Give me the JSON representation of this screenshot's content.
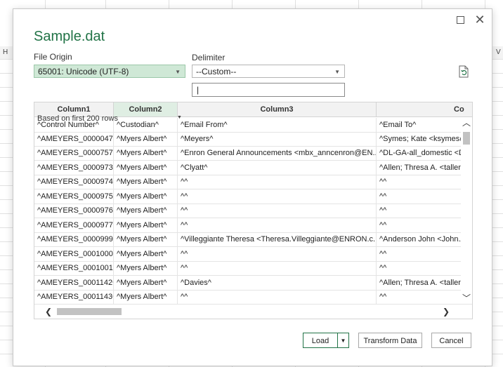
{
  "dialog": {
    "title": "Sample.dat",
    "file_origin_label": "File Origin",
    "file_origin_value": "65001: Unicode (UTF-8)",
    "delimiter_label": "Delimiter",
    "delimiter_value": "--Custom--",
    "custom_delimiter_value": "|",
    "sample_note": "Based on first 200 rows"
  },
  "background": {
    "col_letters": [
      "H",
      "V"
    ]
  },
  "table": {
    "headers": [
      "Column1",
      "Column2",
      "Column3",
      "Co"
    ],
    "rows": [
      [
        "^Control Number^",
        "^Custodian^",
        "^Email From^",
        "^Email To^"
      ],
      [
        "^AMEYERS_0000047^",
        "^Myers Albert^",
        "^Meyers^",
        "^Symes; Kate <ksymes@"
      ],
      [
        "^AMEYERS_0000757^",
        "^Myers Albert^",
        "^Enron General Announcements <mbx_anncenron@EN...",
        "^DL-GA-all_domestic <D"
      ],
      [
        "^AMEYERS_0000973^",
        "^Myers Albert^",
        "^Clyatt^",
        "^Allen; Thresa A. <tallen"
      ],
      [
        "^AMEYERS_0000974^",
        "^Myers Albert^",
        "^^",
        "^^"
      ],
      [
        "^AMEYERS_0000975^",
        "^Myers Albert^",
        "^^",
        "^^"
      ],
      [
        "^AMEYERS_0000976^",
        "^Myers Albert^",
        "^^",
        "^^"
      ],
      [
        "^AMEYERS_0000977^",
        "^Myers Albert^",
        "^^",
        "^^"
      ],
      [
        "^AMEYERS_0000999^",
        "^Myers Albert^",
        "^Villeggiante Theresa <Theresa.Villeggiante@ENRON.c...",
        "^Anderson John <John.A"
      ],
      [
        "^AMEYERS_0001000^",
        "^Myers Albert^",
        "^^",
        "^^"
      ],
      [
        "^AMEYERS_0001001^",
        "^Myers Albert^",
        "^^",
        "^^"
      ],
      [
        "^AMEYERS_0001142^",
        "^Myers Albert^",
        "^Davies^",
        "^Allen; Thresa A. <tallen"
      ],
      [
        "^AMEYERS_0001143^",
        "^Myers Albert^",
        "^^",
        "^^"
      ]
    ]
  },
  "buttons": {
    "load": "Load",
    "transform": "Transform Data",
    "cancel": "Cancel"
  }
}
